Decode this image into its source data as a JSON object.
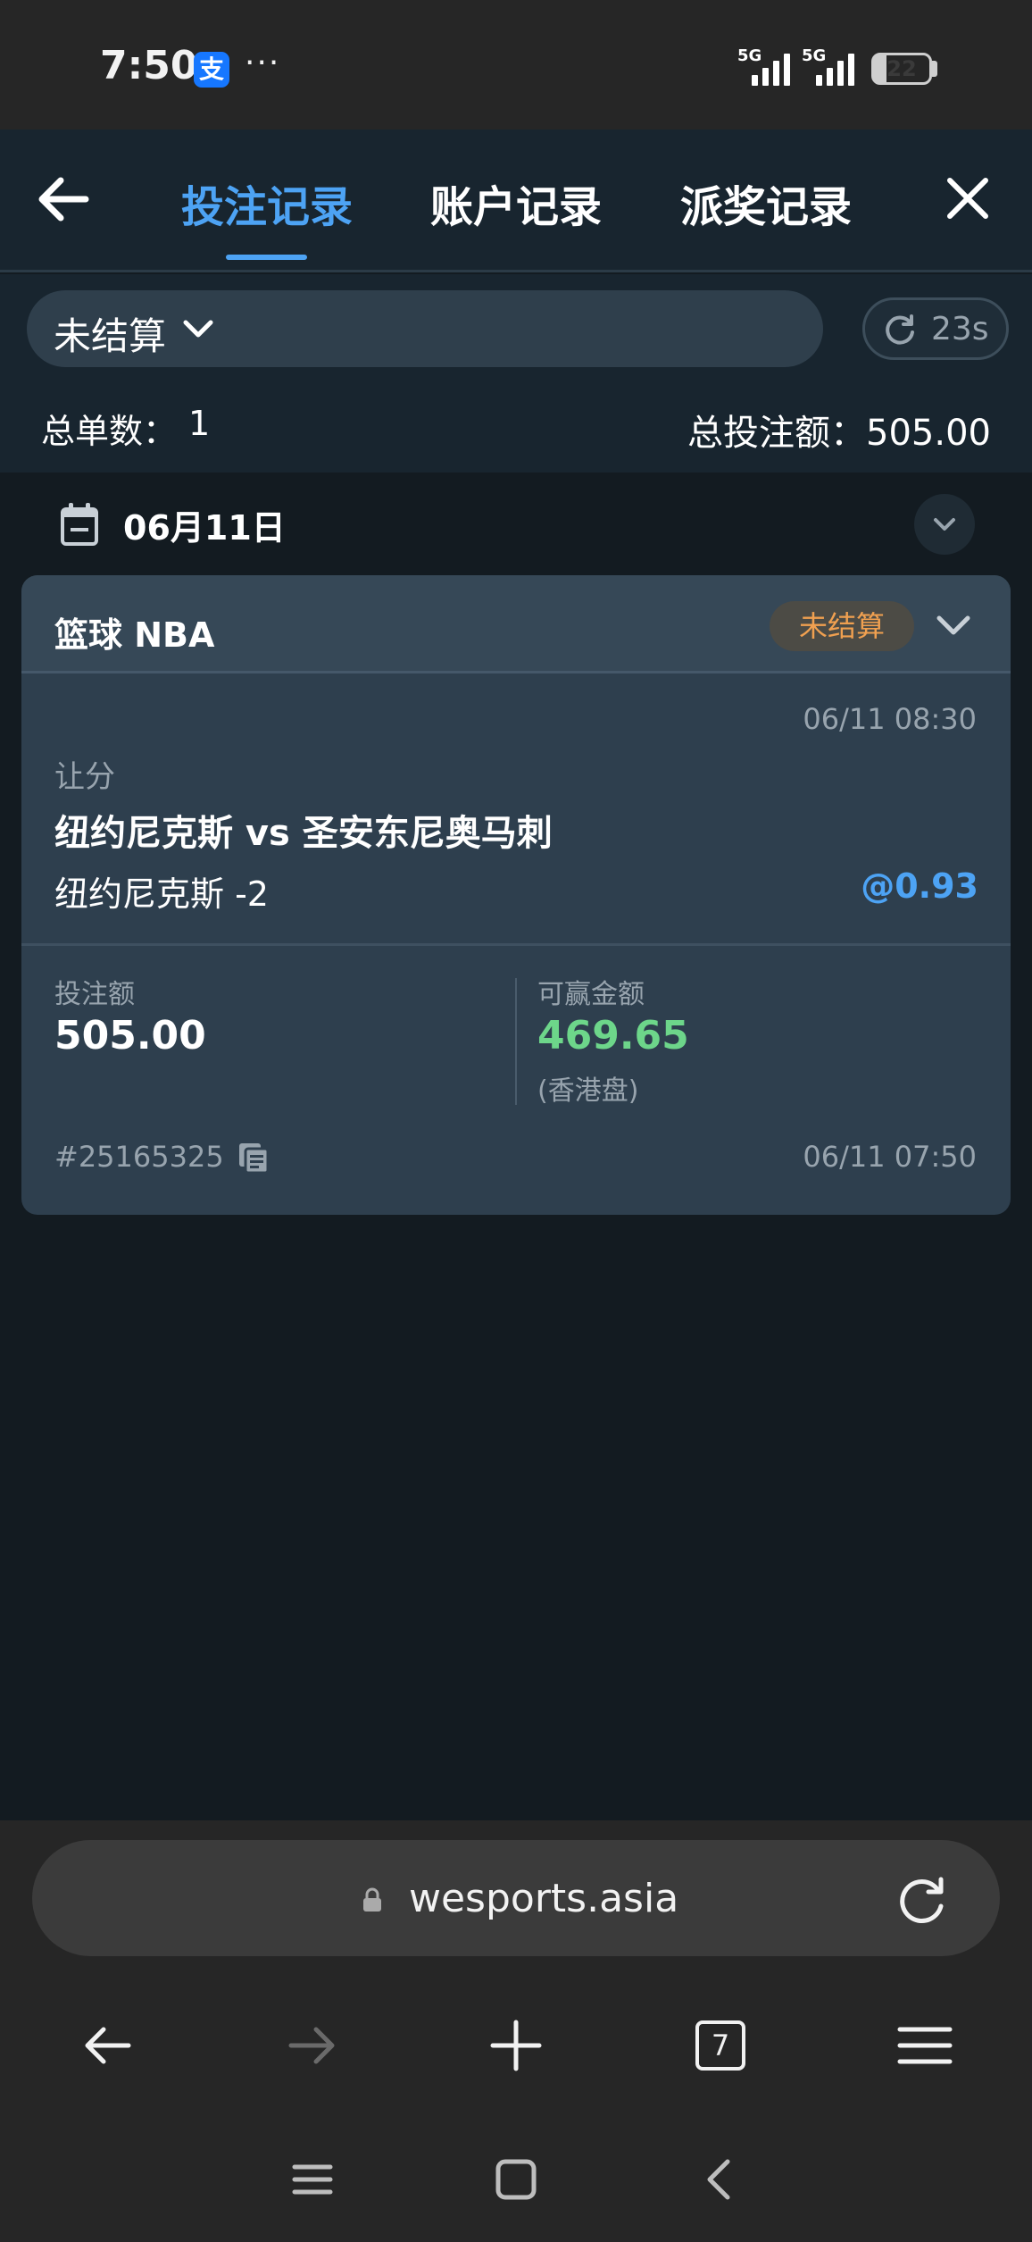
{
  "status_bar": {
    "time": "7:50",
    "alipay_glyph": "支",
    "more": "···",
    "signal_1": "5G",
    "signal_2": "5G",
    "battery": "22"
  },
  "header": {
    "tabs": [
      {
        "label": "投注记录",
        "active": true
      },
      {
        "label": "账户记录",
        "active": false
      },
      {
        "label": "派奖记录",
        "active": false
      }
    ],
    "back_icon": "arrow-left-icon",
    "close_icon": "close-icon"
  },
  "filter": {
    "selected": "未结算",
    "refresh_countdown": "23s"
  },
  "summary": {
    "count_label": "总单数：",
    "count_value": "1",
    "amount_text": "总投注额：505.00"
  },
  "date_group": {
    "date": "06月11日"
  },
  "bet": {
    "league": "篮球 NBA",
    "status": "未结算",
    "event_time": "06/11 08:30",
    "market": "让分",
    "match": "纽约尼克斯 vs 圣安东尼奥马刺",
    "selection": "纽约尼克斯 -2",
    "odds": "@0.93",
    "stake_label": "投注额",
    "stake": "505.00",
    "win_label": "可赢金额",
    "win": "469.65",
    "odds_type": "(香港盘)",
    "ticket_id": "#25165325",
    "placed_time": "06/11 07:50"
  },
  "browser": {
    "url": "wesports.asia",
    "tab_count": "7"
  },
  "colors": {
    "accent": "#4da3f4",
    "win_green": "#6dd68a",
    "pending_orange": "#f0a050"
  }
}
